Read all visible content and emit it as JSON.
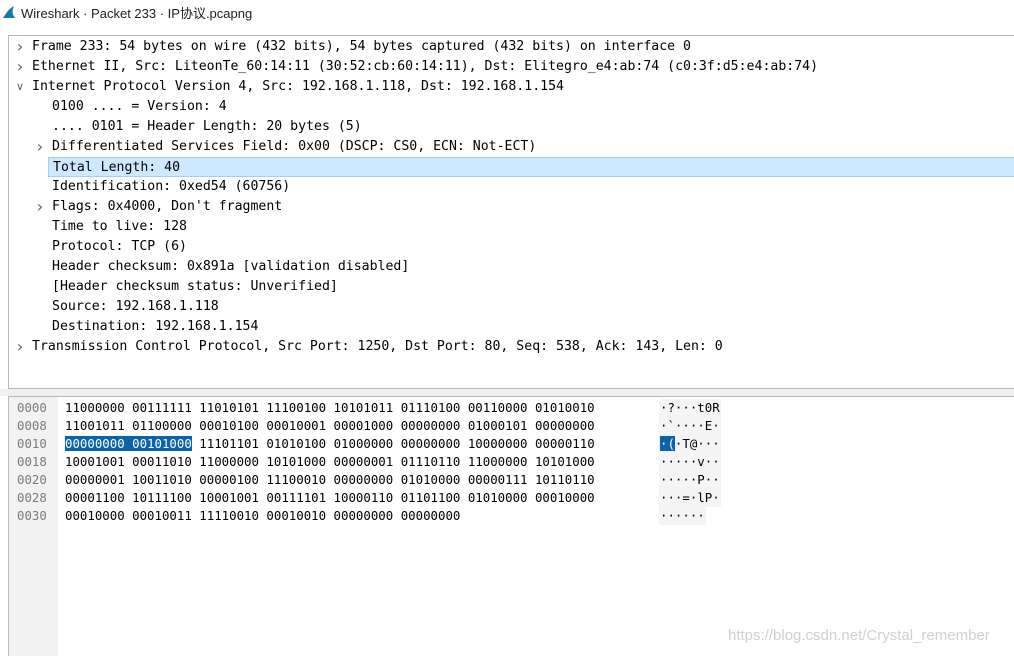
{
  "window": {
    "title": "Wireshark · Packet 233 · IP协议.pcapng",
    "icon": "wireshark-fin-icon"
  },
  "colors": {
    "selected_row_bg": "#cde8ff",
    "selected_row_border": "#99d1ff",
    "byte_highlight_bg": "#0a64ad",
    "offset_color": "#7a7a7a"
  },
  "tree": [
    {
      "text": "Frame 233: 54 bytes on wire (432 bits), 54 bytes captured (432 bits) on interface 0",
      "level": 0,
      "expander": "collapsed"
    },
    {
      "text": "Ethernet II, Src: LiteonTe_60:14:11 (30:52:cb:60:14:11), Dst: Elitegro_e4:ab:74 (c0:3f:d5:e4:ab:74)",
      "level": 0,
      "expander": "collapsed"
    },
    {
      "text": "Internet Protocol Version 4, Src: 192.168.1.118, Dst: 192.168.1.154",
      "level": 0,
      "expander": "expanded"
    },
    {
      "text": "0100 .... = Version: 4",
      "level": 1,
      "expander": "none"
    },
    {
      "text": ".... 0101 = Header Length: 20 bytes (5)",
      "level": 1,
      "expander": "none"
    },
    {
      "text": "Differentiated Services Field: 0x00 (DSCP: CS0, ECN: Not-ECT)",
      "level": 1,
      "expander": "collapsed"
    },
    {
      "text": "Total Length: 40",
      "level": 1,
      "expander": "none",
      "selected": true
    },
    {
      "text": "Identification: 0xed54 (60756)",
      "level": 1,
      "expander": "none"
    },
    {
      "text": "Flags: 0x4000, Don't fragment",
      "level": 1,
      "expander": "collapsed"
    },
    {
      "text": "Time to live: 128",
      "level": 1,
      "expander": "none"
    },
    {
      "text": "Protocol: TCP (6)",
      "level": 1,
      "expander": "none"
    },
    {
      "text": "Header checksum: 0x891a [validation disabled]",
      "level": 1,
      "expander": "none"
    },
    {
      "text": "[Header checksum status: Unverified]",
      "level": 1,
      "expander": "none"
    },
    {
      "text": "Source: 192.168.1.118",
      "level": 1,
      "expander": "none"
    },
    {
      "text": "Destination: 192.168.1.154",
      "level": 1,
      "expander": "none"
    },
    {
      "text": "Transmission Control Protocol, Src Port: 1250, Dst Port: 80, Seq: 538, Ack: 143, Len: 0",
      "level": 0,
      "expander": "collapsed"
    }
  ],
  "bytes": [
    {
      "offset": "0000",
      "pre": "",
      "sel": "",
      "post": "11000000 00111111 11010101 11100100 10101011 01110100 00110000 01010010",
      "ascii_pre": "",
      "ascii_sel": "",
      "ascii_post": "·?···t0R"
    },
    {
      "offset": "0008",
      "pre": "",
      "sel": "",
      "post": "11001011 01100000 00010100 00010001 00001000 00000000 01000101 00000000",
      "ascii_pre": "",
      "ascii_sel": "",
      "ascii_post": "·`····E·"
    },
    {
      "offset": "0010",
      "pre": "",
      "sel": "00000000 00101000",
      "post": " 11101101 01010100 01000000 00000000 10000000 00000110",
      "ascii_pre": "",
      "ascii_sel": "·(",
      "ascii_post": "·T@···"
    },
    {
      "offset": "0018",
      "pre": "",
      "sel": "",
      "post": "10001001 00011010 11000000 10101000 00000001 01110110 11000000 10101000",
      "ascii_pre": "",
      "ascii_sel": "",
      "ascii_post": "·····v··"
    },
    {
      "offset": "0020",
      "pre": "",
      "sel": "",
      "post": "00000001 10011010 00000100 11100010 00000000 01010000 00000111 10110110",
      "ascii_pre": "",
      "ascii_sel": "",
      "ascii_post": "·····P··"
    },
    {
      "offset": "0028",
      "pre": "",
      "sel": "",
      "post": "00001100 10111100 10001001 00111101 10000110 01101100 01010000 00010000",
      "ascii_pre": "",
      "ascii_sel": "",
      "ascii_post": "···=·lP·"
    },
    {
      "offset": "0030",
      "pre": "",
      "sel": "",
      "post": "00010000 00010011 11110010 00010010 00000000 00000000",
      "ascii_pre": "",
      "ascii_sel": "",
      "ascii_post": "······"
    }
  ],
  "watermark": "https://blog.csdn.net/Crystal_remember"
}
